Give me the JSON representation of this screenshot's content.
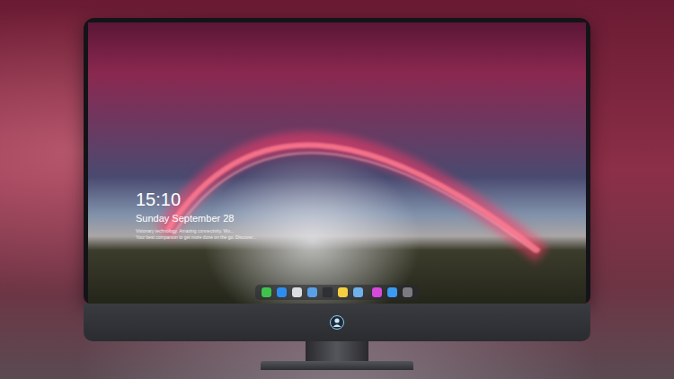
{
  "lock_screen": {
    "time": "15:10",
    "date": "Sunday September 28",
    "notice": [
      "Visionary technology. Amazing connectivity. Wo...",
      "Your best companion to get more done on the go. Discover..."
    ]
  },
  "dock": {
    "groups": [
      {
        "items": [
          {
            "color": "#3fc24e"
          },
          {
            "color": "#2d8ef0"
          },
          {
            "color": "#d9dce0"
          },
          {
            "color": "#5aa0e6"
          },
          {
            "color": "#2f3036"
          },
          {
            "color": "#f5d040"
          },
          {
            "color": "#6fb1e8"
          }
        ]
      },
      {
        "items": [
          {
            "color": "#d54ad9"
          },
          {
            "color": "#3a9bf0"
          },
          {
            "color": "#7a7a80"
          }
        ]
      }
    ]
  }
}
